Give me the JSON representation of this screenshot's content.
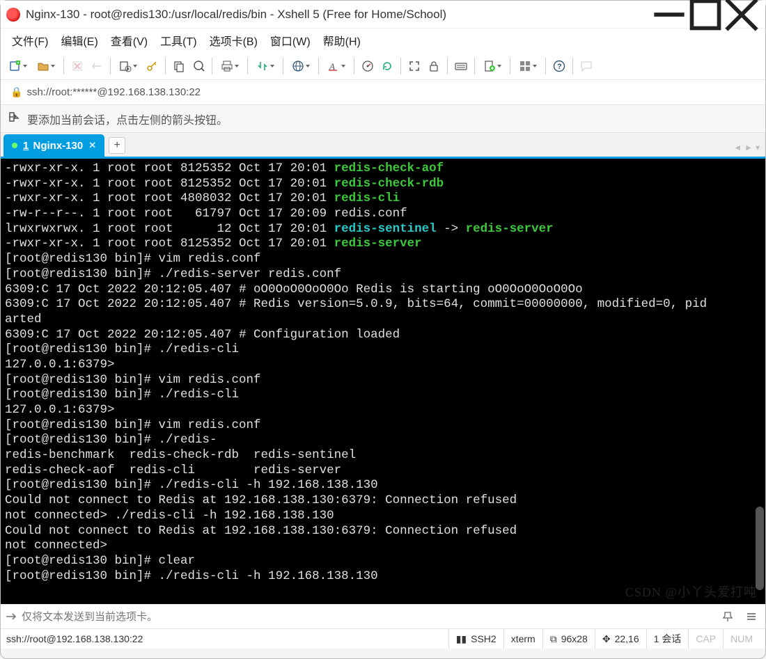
{
  "window": {
    "title": "Nginx-130 - root@redis130:/usr/local/redis/bin - Xshell 5 (Free for Home/School)"
  },
  "menu": {
    "items": [
      "文件(F)",
      "编辑(E)",
      "查看(V)",
      "工具(T)",
      "选项卡(B)",
      "窗口(W)",
      "帮助(H)"
    ]
  },
  "toolbar": {
    "items": [
      {
        "name": "new-session-button",
        "icon": "new",
        "dd": true
      },
      {
        "name": "open-session-button",
        "icon": "open",
        "dd": true
      },
      {
        "sep": true
      },
      {
        "name": "reconnect-button",
        "icon": "reconnect",
        "disabled": true
      },
      {
        "name": "disconnect-button",
        "icon": "disconnect",
        "disabled": true
      },
      {
        "sep": true
      },
      {
        "name": "properties-button",
        "icon": "props",
        "dd": true
      },
      {
        "name": "keygen-button",
        "icon": "keygen"
      },
      {
        "sep": true
      },
      {
        "name": "copy-button",
        "icon": "copy"
      },
      {
        "name": "paste-button",
        "icon": "paste"
      },
      {
        "sep": true
      },
      {
        "name": "print-button",
        "icon": "print",
        "dd": true
      },
      {
        "sep": true
      },
      {
        "name": "transfer-button",
        "icon": "transfer",
        "dd": true
      },
      {
        "sep": true
      },
      {
        "name": "globe-button",
        "icon": "globe",
        "dd": true
      },
      {
        "sep": true
      },
      {
        "name": "text-style-button",
        "icon": "textA",
        "dd": true
      },
      {
        "sep": true
      },
      {
        "name": "dashboard-button",
        "icon": "gauge"
      },
      {
        "name": "refresh-button",
        "icon": "refresh"
      },
      {
        "sep": true
      },
      {
        "name": "fullscreen-button",
        "icon": "expand"
      },
      {
        "name": "lock-button",
        "icon": "lock"
      },
      {
        "sep": true
      },
      {
        "name": "keyboard-button",
        "icon": "keyboard"
      },
      {
        "sep": true
      },
      {
        "name": "new-file-button",
        "icon": "newfile",
        "dd": true
      },
      {
        "sep": true
      },
      {
        "name": "grid-button",
        "icon": "grid",
        "dd": true
      },
      {
        "sep": true
      },
      {
        "name": "help-button",
        "icon": "help"
      },
      {
        "sep": true
      },
      {
        "name": "chat-button",
        "icon": "chat",
        "disabled": true
      }
    ]
  },
  "addressbar": {
    "text": "ssh://root:******@192.168.138.130:22"
  },
  "hint": {
    "text": "要添加当前会话，点击左侧的箭头按钮。"
  },
  "tabs": {
    "active": {
      "num": "1",
      "label": "Nginx-130"
    }
  },
  "terminal": {
    "lines": [
      {
        "segs": [
          {
            "t": "-rwxr-xr-x. 1 root root 8125352 Oct 17 20:01 "
          },
          {
            "t": "redis-check-aof",
            "cls": "g"
          }
        ]
      },
      {
        "segs": [
          {
            "t": "-rwxr-xr-x. 1 root root 8125352 Oct 17 20:01 "
          },
          {
            "t": "redis-check-rdb",
            "cls": "g"
          }
        ]
      },
      {
        "segs": [
          {
            "t": "-rwxr-xr-x. 1 root root 4808032 Oct 17 20:01 "
          },
          {
            "t": "redis-cli",
            "cls": "g"
          }
        ]
      },
      {
        "segs": [
          {
            "t": "-rw-r--r--. 1 root root   61797 Oct 17 20:09 redis.conf"
          }
        ]
      },
      {
        "segs": [
          {
            "t": "lrwxrwxrwx. 1 root root      12 Oct 17 20:01 "
          },
          {
            "t": "redis-sentinel",
            "cls": "c"
          },
          {
            "t": " -> "
          },
          {
            "t": "redis-server",
            "cls": "g"
          }
        ]
      },
      {
        "segs": [
          {
            "t": "-rwxr-xr-x. 1 root root 8125352 Oct 17 20:01 "
          },
          {
            "t": "redis-server",
            "cls": "g"
          }
        ]
      },
      {
        "segs": [
          {
            "t": "[root@redis130 bin]# vim redis.conf"
          }
        ]
      },
      {
        "segs": [
          {
            "t": "[root@redis130 bin]# ./redis-server redis.conf"
          }
        ]
      },
      {
        "segs": [
          {
            "t": "6309:C 17 Oct 2022 20:12:05.407 # oO0OoO0OoO0Oo Redis is starting oO0OoO0OoO0Oo"
          }
        ]
      },
      {
        "segs": [
          {
            "t": "6309:C 17 Oct 2022 20:12:05.407 # Redis version=5.0.9, bits=64, commit=00000000, modified=0, pid"
          }
        ]
      },
      {
        "segs": [
          {
            "t": "arted"
          }
        ]
      },
      {
        "segs": [
          {
            "t": "6309:C 17 Oct 2022 20:12:05.407 # Configuration loaded"
          }
        ]
      },
      {
        "segs": [
          {
            "t": "[root@redis130 bin]# ./redis-cli"
          }
        ]
      },
      {
        "segs": [
          {
            "t": "127.0.0.1:6379>"
          }
        ]
      },
      {
        "segs": [
          {
            "t": "[root@redis130 bin]# vim redis.conf"
          }
        ]
      },
      {
        "segs": [
          {
            "t": "[root@redis130 bin]# ./redis-cli"
          }
        ]
      },
      {
        "segs": [
          {
            "t": "127.0.0.1:6379>"
          }
        ]
      },
      {
        "segs": [
          {
            "t": "[root@redis130 bin]# vim redis.conf"
          }
        ]
      },
      {
        "segs": [
          {
            "t": "[root@redis130 bin]# ./redis-"
          }
        ]
      },
      {
        "segs": [
          {
            "t": "redis-benchmark  redis-check-rdb  redis-sentinel"
          }
        ]
      },
      {
        "segs": [
          {
            "t": "redis-check-aof  redis-cli        redis-server"
          }
        ]
      },
      {
        "segs": [
          {
            "t": "[root@redis130 bin]# ./redis-cli -h 192.168.138.130"
          }
        ]
      },
      {
        "segs": [
          {
            "t": "Could not connect to Redis at 192.168.138.130:6379: Connection refused"
          }
        ]
      },
      {
        "segs": [
          {
            "t": "not connected> ./redis-cli -h 192.168.138.130"
          }
        ]
      },
      {
        "segs": [
          {
            "t": "Could not connect to Redis at 192.168.138.130:6379: Connection refused"
          }
        ]
      },
      {
        "segs": [
          {
            "t": "not connected>"
          }
        ]
      },
      {
        "segs": [
          {
            "t": "[root@redis130 bin]# clear"
          }
        ]
      },
      {
        "segs": [
          {
            "t": "[root@redis130 bin]# ./redis-cli -h 192.168.138.130"
          }
        ]
      }
    ],
    "watermark": "CSDN @小丫头爱打吨"
  },
  "sendbar": {
    "placeholder": "仅将文本发送到当前选项卡。"
  },
  "statusbar": {
    "left": "ssh://root@192.168.138.130:22",
    "ssh": "SSH2",
    "term": "xterm",
    "size": "96x28",
    "cursor": "22,16",
    "sessions": "1 会话",
    "caps": "CAP",
    "num": "NUM"
  }
}
